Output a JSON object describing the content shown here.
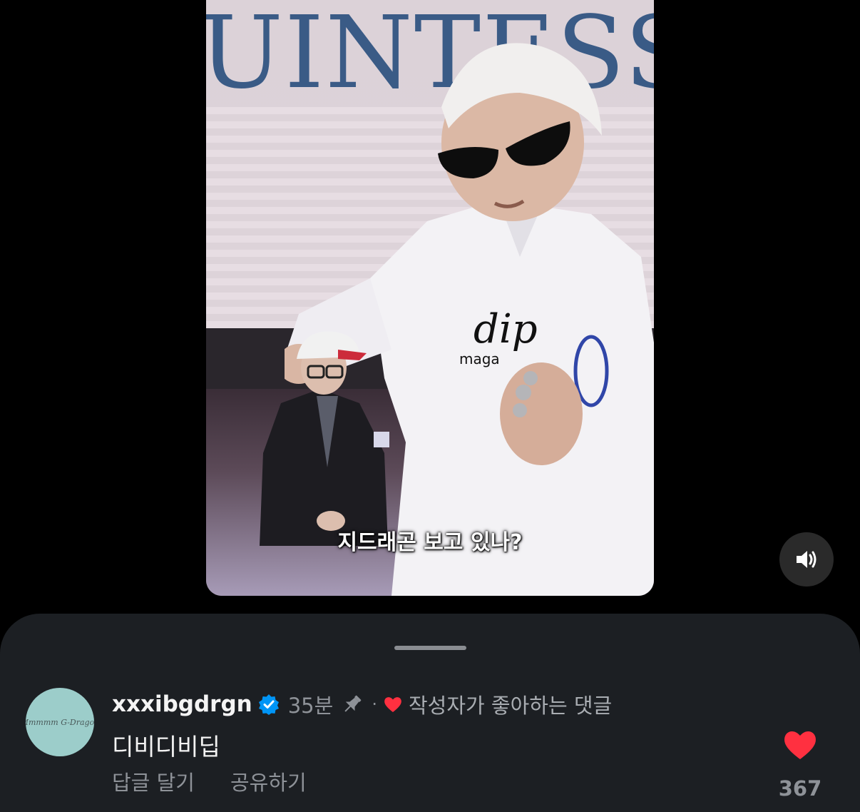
{
  "video": {
    "backdrop_text": "UINTESS",
    "caption": "지드래곤 보고 있나?",
    "volume_icon": "speaker-on-icon"
  },
  "comment": {
    "avatar_text": "Mmmmm G-Dragon",
    "username": "xxxibgdrgn",
    "verified_icon": "verified-badge-icon",
    "time": "35분",
    "pin_icon": "pin-icon",
    "separator": "·",
    "creator_liked_label": "작성자가 좋아하는 댓글",
    "text": "디비디비딥",
    "actions": {
      "reply": "답글 달기",
      "share": "공유하기"
    },
    "like_count": "367"
  },
  "colors": {
    "sheet_bg": "#1c1f23",
    "heart_red": "#ff3040",
    "verified_blue": "#0095f6"
  }
}
